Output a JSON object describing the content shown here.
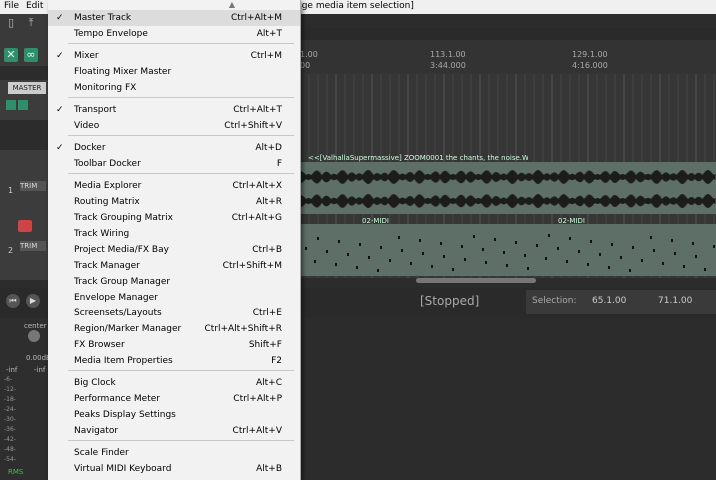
{
  "menubar": {
    "file": "File",
    "edit": "Edit"
  },
  "title_fragment": "nge media item selection]",
  "ruler": [
    {
      "bar": "113.1.00",
      "time": "3:44.000"
    },
    {
      "bar": "129.1.00",
      "time": "4:16.000"
    },
    {
      "bar": "1.00",
      "time": "00"
    }
  ],
  "master_label": "MASTER",
  "tracks": [
    {
      "num": "1",
      "clip": "<<[ValhallaSupermassive] ZOOM0001 the chants, the noise.WAV",
      "trim": "TRIM"
    },
    {
      "num": "2",
      "clip": "02-MIDI",
      "trim": "TRIM"
    }
  ],
  "transport": {
    "status": "[Stopped]",
    "selection_label": "Selection:",
    "sel_start": "65.1.00",
    "sel_end": "71.1.00"
  },
  "mixer": {
    "pan": "center",
    "db": "0.00dB",
    "inf1": "-inf",
    "inf2": "-inf",
    "rms": "RMS",
    "scale": [
      "-6-",
      "-12-",
      "-18-",
      "-24-",
      "-30-",
      "-36-",
      "-42-",
      "-48-",
      "-54-"
    ]
  },
  "menu_items": [
    {
      "check": "✓",
      "label": "Master Track",
      "shortcut": "Ctrl+Alt+M"
    },
    {
      "check": "",
      "label": "Tempo Envelope",
      "shortcut": "Alt+T"
    },
    {
      "check": "✓",
      "label": "Mixer",
      "shortcut": "Ctrl+M"
    },
    {
      "check": "",
      "label": "Floating Mixer Master",
      "shortcut": ""
    },
    {
      "check": "",
      "label": "Monitoring FX",
      "shortcut": ""
    },
    {
      "check": "✓",
      "label": "Transport",
      "shortcut": "Ctrl+Alt+T"
    },
    {
      "check": "",
      "label": "Video",
      "shortcut": "Ctrl+Shift+V"
    },
    {
      "check": "✓",
      "label": "Docker",
      "shortcut": "Alt+D"
    },
    {
      "check": "",
      "label": "Toolbar Docker",
      "shortcut": "F"
    },
    {
      "check": "",
      "label": "Media Explorer",
      "shortcut": "Ctrl+Alt+X"
    },
    {
      "check": "",
      "label": "Routing Matrix",
      "shortcut": "Alt+R"
    },
    {
      "check": "",
      "label": "Track Grouping Matrix",
      "shortcut": "Ctrl+Alt+G"
    },
    {
      "check": "",
      "label": "Track Wiring",
      "shortcut": ""
    },
    {
      "check": "",
      "label": "Project Media/FX Bay",
      "shortcut": "Ctrl+B"
    },
    {
      "check": "",
      "label": "Track Manager",
      "shortcut": "Ctrl+Shift+M"
    },
    {
      "check": "",
      "label": "Track Group Manager",
      "shortcut": ""
    },
    {
      "check": "",
      "label": "Envelope Manager",
      "shortcut": ""
    },
    {
      "check": "",
      "label": "Screensets/Layouts",
      "shortcut": "Ctrl+E"
    },
    {
      "check": "",
      "label": "Region/Marker Manager",
      "shortcut": "Ctrl+Alt+Shift+R"
    },
    {
      "check": "",
      "label": "FX Browser",
      "shortcut": "Shift+F"
    },
    {
      "check": "",
      "label": "Media Item Properties",
      "shortcut": "F2"
    },
    {
      "check": "",
      "label": "Big Clock",
      "shortcut": "Alt+C"
    },
    {
      "check": "",
      "label": "Performance Meter",
      "shortcut": "Ctrl+Alt+P"
    },
    {
      "check": "",
      "label": "Peaks Display Settings",
      "shortcut": ""
    },
    {
      "check": "",
      "label": "Navigator",
      "shortcut": "Ctrl+Alt+V"
    },
    {
      "check": "",
      "label": "Scale Finder",
      "shortcut": ""
    },
    {
      "check": "",
      "label": "Virtual MIDI Keyboard",
      "shortcut": "Alt+B"
    }
  ],
  "colors": {
    "accent": "#2f8f6d",
    "menu_bg": "#f2f2f2",
    "clip": "#5a7a6a"
  }
}
